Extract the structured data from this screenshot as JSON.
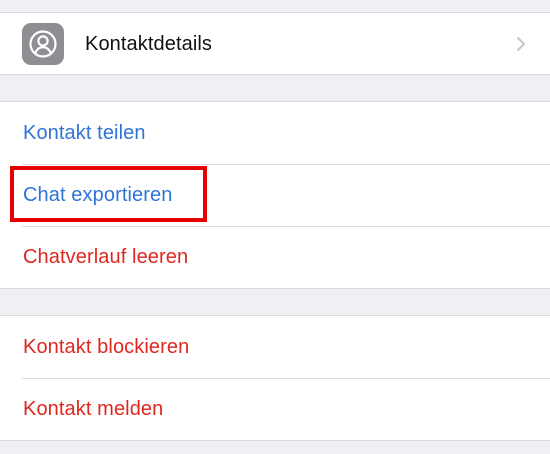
{
  "contact_section": {
    "details_label": "Kontaktdetails",
    "icon": "person-circle-icon",
    "chevron_icon": "chevron-right-icon"
  },
  "actions_section": {
    "share_label": "Kontakt teilen",
    "export_label": "Chat exportieren",
    "clear_label": "Chatverlauf leeren"
  },
  "danger_section": {
    "block_label": "Kontakt blockieren",
    "report_label": "Kontakt melden"
  },
  "colors": {
    "action_blue": "#2f74d8",
    "destructive_red": "#e0271f",
    "highlight_red": "#e60000",
    "background": "#efeff4"
  }
}
